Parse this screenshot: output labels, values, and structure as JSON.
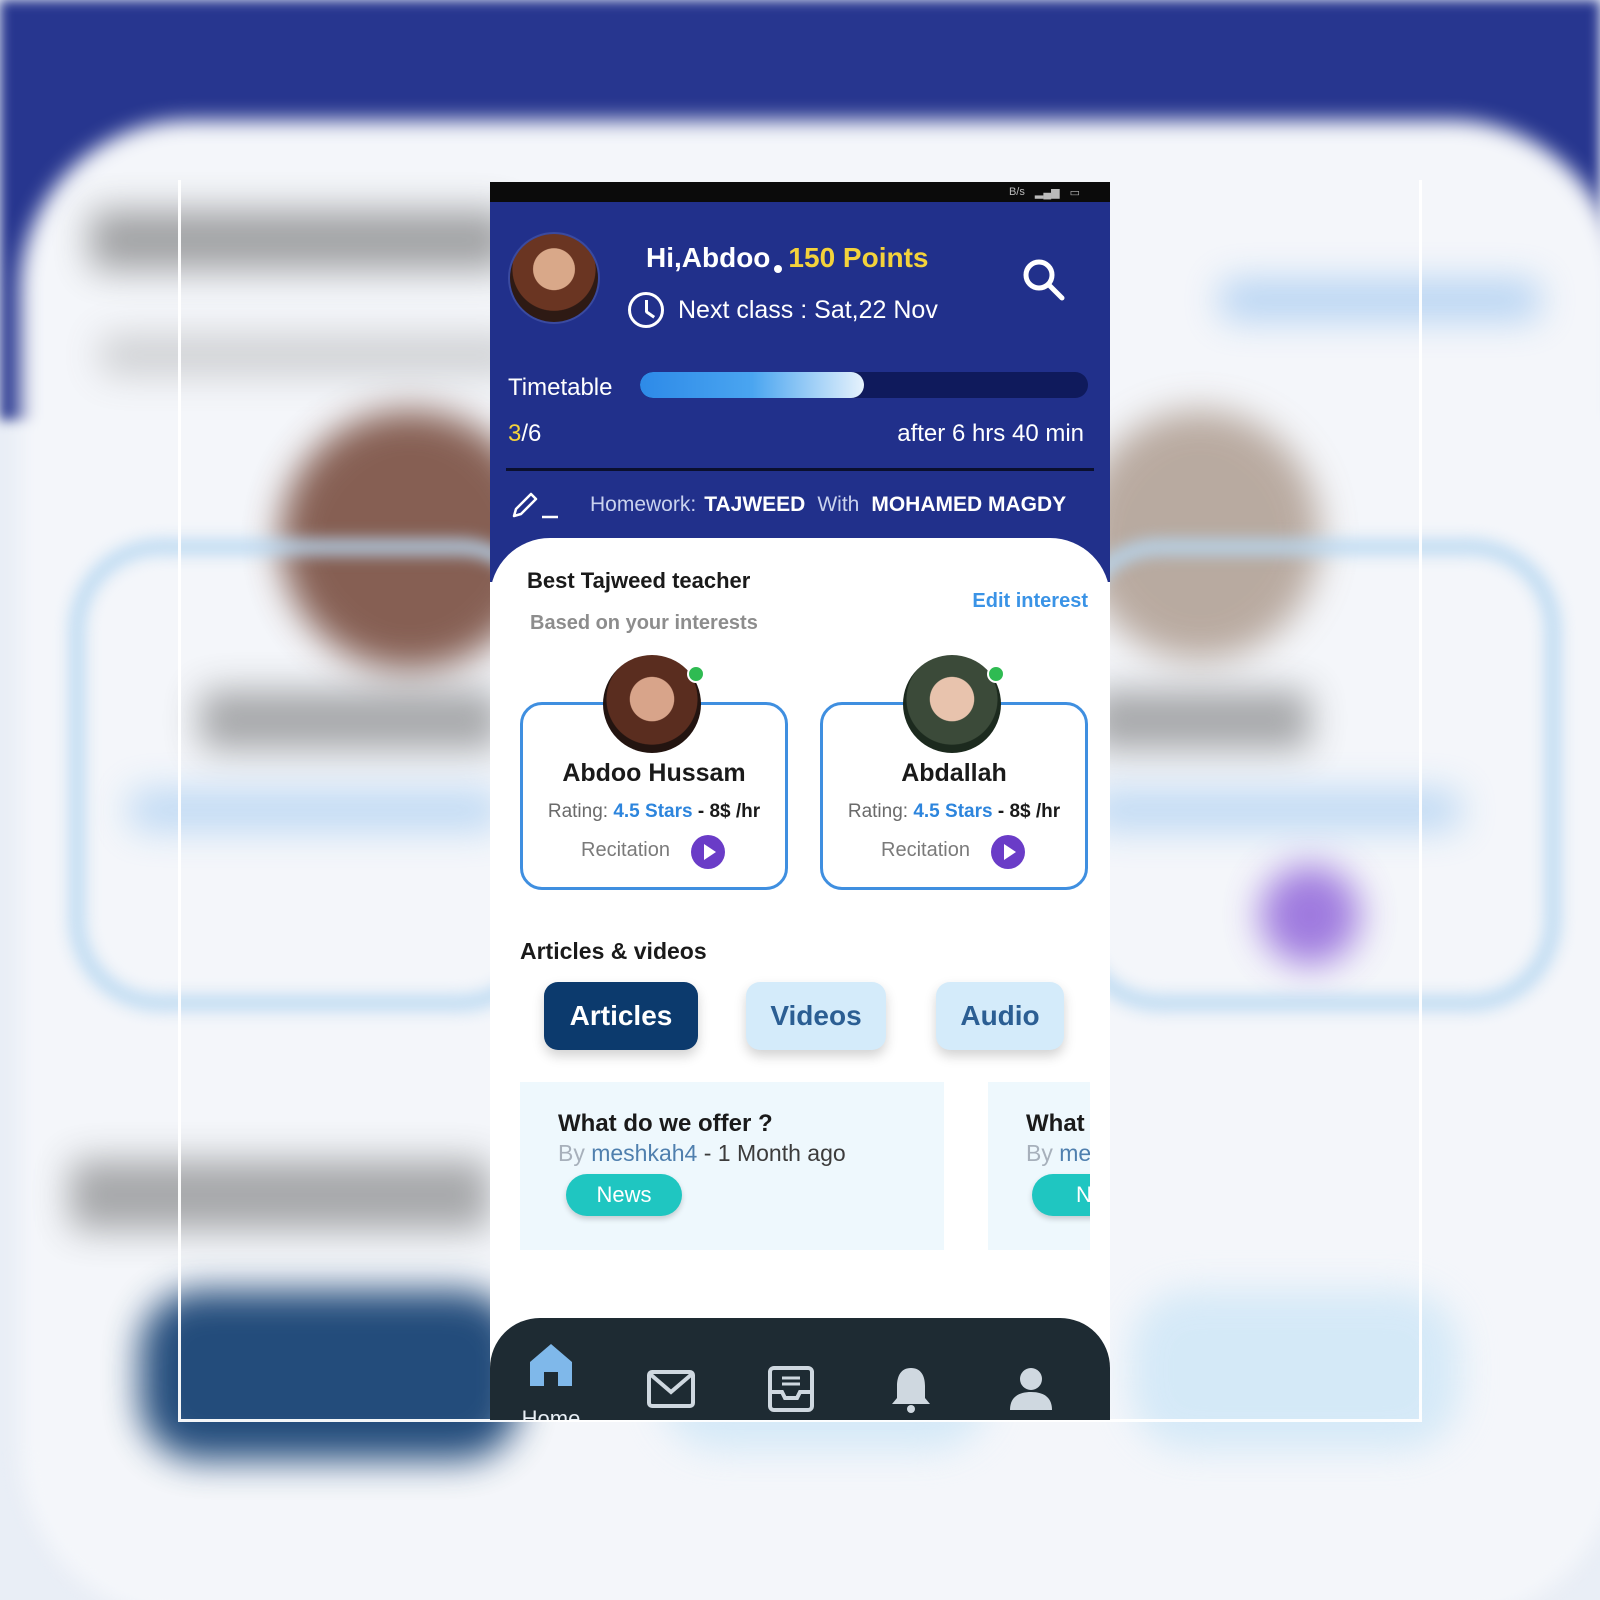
{
  "colors": {
    "header_bg": "#21308b",
    "points": "#f4d23b",
    "accent_blue": "#3a93e6",
    "tab_active": "#0c3a6d",
    "tab_inactive": "#d4ebfa",
    "badge": "#1fc6c1",
    "play": "#6a3cc7",
    "online": "#2fbb52",
    "nav_bg": "#1e2b33"
  },
  "header": {
    "greeting": "Hi,Abdoo",
    "points": "150 Points",
    "next_class": "Next class : Sat,22 Nov",
    "search_icon": "search-icon",
    "clock_icon": "clock-icon"
  },
  "timetable": {
    "label": "Timetable",
    "progress": 0.5,
    "current": "3",
    "total": "/6",
    "countdown": "after 6 hrs 40 min"
  },
  "homework": {
    "icon": "pencil-icon",
    "label": "Homework:",
    "subject": "TAJWEED",
    "with": "With",
    "teacher": "MOHAMED MAGDY"
  },
  "best_teacher": {
    "title": "Best Tajweed teacher",
    "subtitle": "Based on your interests",
    "edit": "Edit interest",
    "teachers": [
      {
        "name": "Abdoo Hussam",
        "rating_label": "Rating:",
        "stars": "4.5 Stars",
        "price": "- 8$ /hr",
        "specialty": "Recitation",
        "online": true
      },
      {
        "name": "Abdallah",
        "rating_label": "Rating:",
        "stars": "4.5 Stars",
        "price": "- 8$ /hr",
        "specialty": "Recitation",
        "online": true
      }
    ]
  },
  "articles": {
    "title": "Articles & videos",
    "tabs": [
      {
        "label": "Articles",
        "active": true
      },
      {
        "label": "Videos",
        "active": false
      },
      {
        "label": "Audio",
        "active": false
      }
    ],
    "items": [
      {
        "title": "What do we offer ?",
        "by": "By",
        "author": "meshkah4",
        "time": "- 1 Month ago",
        "tag": "News"
      },
      {
        "title": "What",
        "by": "By",
        "author": "me",
        "time": "",
        "tag": "Ne"
      }
    ]
  },
  "nav": {
    "items": [
      {
        "icon": "home-icon",
        "label": "Home"
      },
      {
        "icon": "mail-icon",
        "label": ""
      },
      {
        "icon": "inbox-icon",
        "label": ""
      },
      {
        "icon": "bell-icon",
        "label": ""
      },
      {
        "icon": "profile-icon",
        "label": ""
      }
    ]
  },
  "status_bar": {
    "speed_unit": "B/s"
  }
}
